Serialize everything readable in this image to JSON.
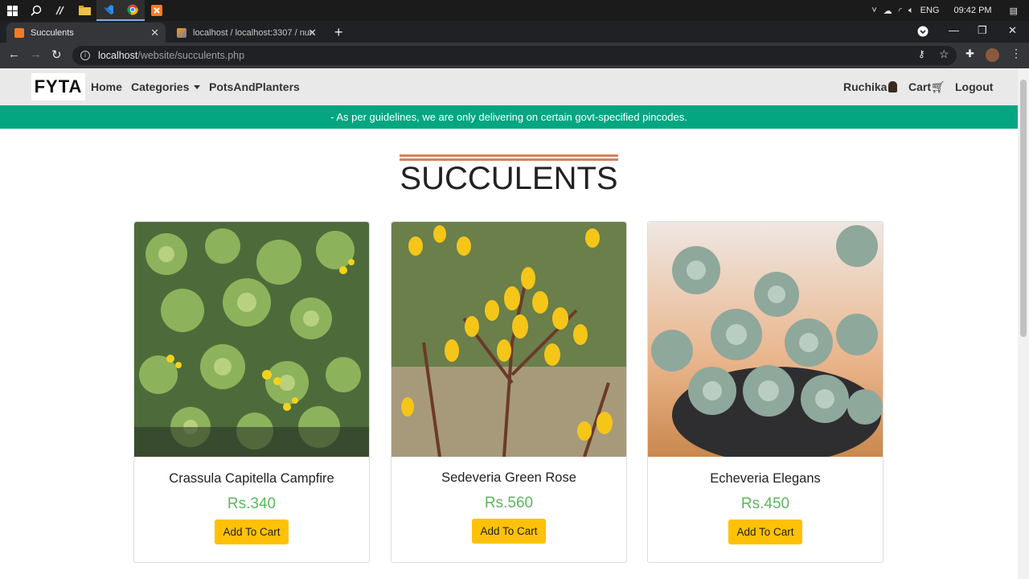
{
  "taskbar": {
    "lang": "ENG",
    "time": "09:42 PM"
  },
  "browser": {
    "tabs": [
      {
        "label": "Succulents",
        "active": true
      },
      {
        "label": "localhost / localhost:3307 / nurse",
        "active": false
      }
    ],
    "url_host": "localhost",
    "url_path": "/website/succulents.php"
  },
  "nav": {
    "logo": "FYTA",
    "home": "Home",
    "categories": "Categories",
    "pots": "PotsAndPlanters",
    "user": "Ruchika",
    "cart": "Cart",
    "logout": "Logout"
  },
  "notice": "- As per guidelines, we are only delivering on certain govt-specified pincodes.",
  "page_title": "SUCCULENTS",
  "products": [
    {
      "name": "Crassula Capitella Campfire",
      "price": "Rs.340",
      "button": "Add To Cart"
    },
    {
      "name": "Sedeveria Green Rose",
      "price": "Rs.560",
      "button": "Add To Cart"
    },
    {
      "name": "Echeveria Elegans",
      "price": "Rs.450",
      "button": "Add To Cart"
    }
  ],
  "colors": {
    "accent_green": "#04a682",
    "price_green": "#5cb85c",
    "button_yellow": "#ffc107",
    "heading_rule": "#d9805c"
  }
}
